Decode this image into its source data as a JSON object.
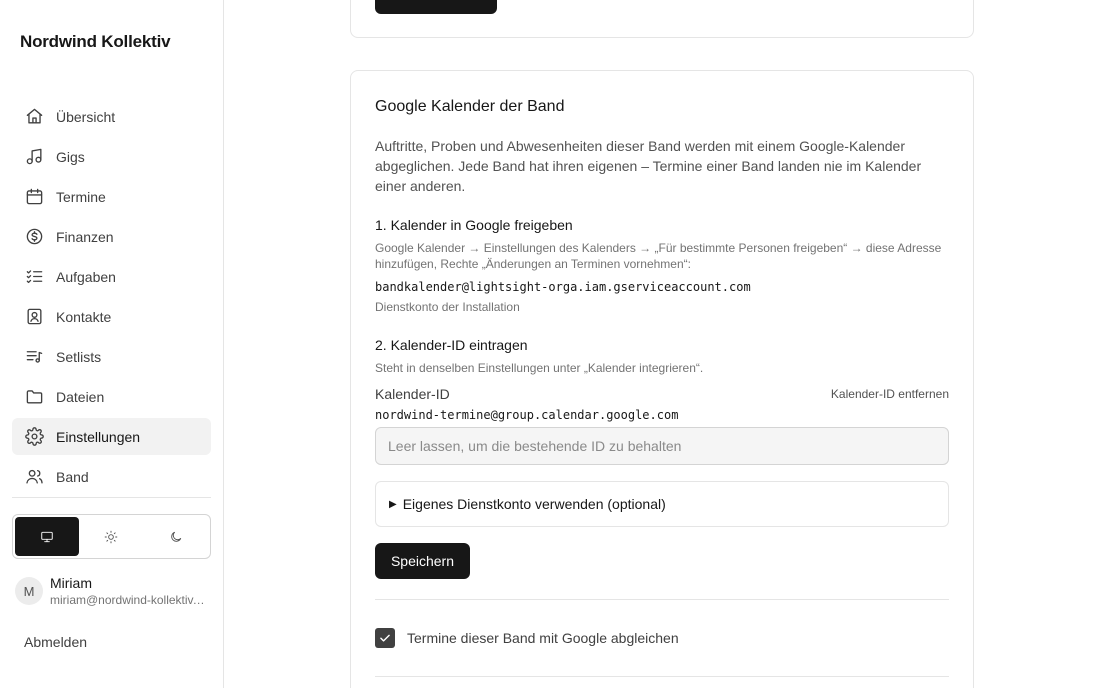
{
  "app": {
    "brand": "Nordwind Kollektiv"
  },
  "sidebar": {
    "items": [
      {
        "label": "Übersicht",
        "icon": "home-icon"
      },
      {
        "label": "Gigs",
        "icon": "music-note-icon"
      },
      {
        "label": "Termine",
        "icon": "calendar-icon"
      },
      {
        "label": "Finanzen",
        "icon": "dollar-circle-icon"
      },
      {
        "label": "Aufgaben",
        "icon": "checklist-icon"
      },
      {
        "label": "Kontakte",
        "icon": "contact-book-icon"
      },
      {
        "label": "Setlists",
        "icon": "list-music-icon"
      },
      {
        "label": "Dateien",
        "icon": "folder-icon"
      },
      {
        "label": "Einstellungen",
        "icon": "gear-icon",
        "active": true
      },
      {
        "label": "Band",
        "icon": "users-icon"
      }
    ],
    "theme": {
      "options": [
        "monitor-icon",
        "sun-icon",
        "moon-icon"
      ],
      "selected": "system"
    },
    "user": {
      "initial": "M",
      "name": "Miriam",
      "email": "miriam@nordwind-kollektiv.de"
    },
    "logout_label": "Abmelden"
  },
  "calendar_card": {
    "title": "Google Kalender der Band",
    "intro": "Auftritte, Proben und Abwesenheiten dieser Band werden mit einem Google-Kalender abgeglichen. Jede Band hat ihren eigenen – Termine einer Band landen nie im Kalender einer anderen.",
    "step1": {
      "title": "1. Kalender in Google freigeben",
      "desc": "Google Kalender → Einstellungen des Kalenders → „Für bestimmte Personen freigeben“ → diese Adresse hinzufügen, Rechte „Änderungen an Terminen vornehmen“:",
      "service_account": "bandkalender@lightsight-orga.iam.gserviceaccount.com",
      "service_account_note": "Dienstkonto der Installation"
    },
    "step2": {
      "title": "2. Kalender-ID eintragen",
      "desc": "Steht in denselben Einstellungen unter „Kalender integrieren“.",
      "field_label": "Kalender-ID",
      "remove_label": "Kalender-ID entfernen",
      "current_id": "nordwind-termine@group.calendar.google.com",
      "input_value": "",
      "input_placeholder": "Leer lassen, um die bestehende ID zu behalten"
    },
    "own_account_label": "Eigenes Dienstkonto verwenden (optional)",
    "save_label": "Speichern",
    "sync_checkbox": {
      "label": "Termine dieser Band mit Google abgleichen",
      "checked": true
    }
  },
  "colors": {
    "accent": "#171717",
    "border": "#e5e5e5",
    "muted_text": "#737373"
  }
}
